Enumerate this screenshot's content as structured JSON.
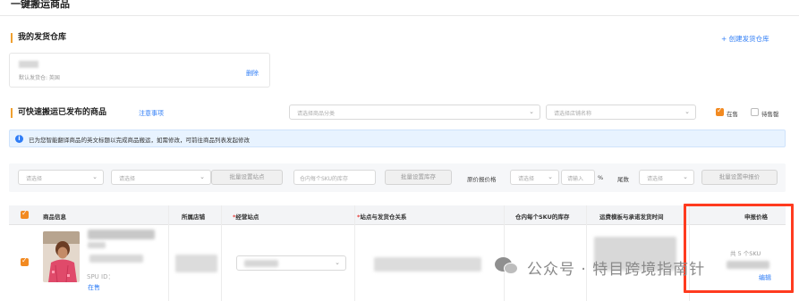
{
  "header": {
    "title": "一键搬运商品"
  },
  "warehouse": {
    "title": "我的发货仓库",
    "create_link": "+ 创建发货仓库",
    "sub_text": "默认发货仓: 英国",
    "delete_label": "删除"
  },
  "products": {
    "title": "可快速搬运已发布的商品",
    "notes_link": "注意事项",
    "category_placeholder": "请选择商品分类",
    "store_placeholder": "请选择店铺名称",
    "on_sale_label": "在售",
    "sold_out_label": "待售罄"
  },
  "notice": {
    "text": "已为您智能翻译商品的英文标题以完成商品搬运，如需修改，可前往商品列表发起修改"
  },
  "bulk": {
    "select1": "请选择",
    "select2": "请选择",
    "set_site_btn": "批量设置站点",
    "stock_placeholder": "仓内每个SKU的库存",
    "set_stock_btn": "批量设置库存",
    "price_label": "原价报价格",
    "price_select": "请选择",
    "price_input": "请输入",
    "percent": "%",
    "tail_label": "尾数",
    "tail_select": "请选择",
    "set_price_btn": "批量设置申报价"
  },
  "table": {
    "headers": {
      "product_info": "商品信息",
      "store": "所属店铺",
      "site": "经营站点",
      "site_warehouse": "站点与发货仓关系",
      "stock": "仓内每个SKU的库存",
      "shipping": "运费模板与承诺发货时间",
      "price": "申报价格"
    },
    "row": {
      "spu_label": "SPU ID：",
      "status": "在售",
      "sku_count": "共 5 个SKU",
      "edit_link": "编辑"
    }
  },
  "watermark": {
    "text": "公众号 · 特目跨境指南针"
  },
  "colors": {
    "accent": "#f28a21",
    "link": "#2f7df6",
    "highlight": "#ff3b1f"
  }
}
